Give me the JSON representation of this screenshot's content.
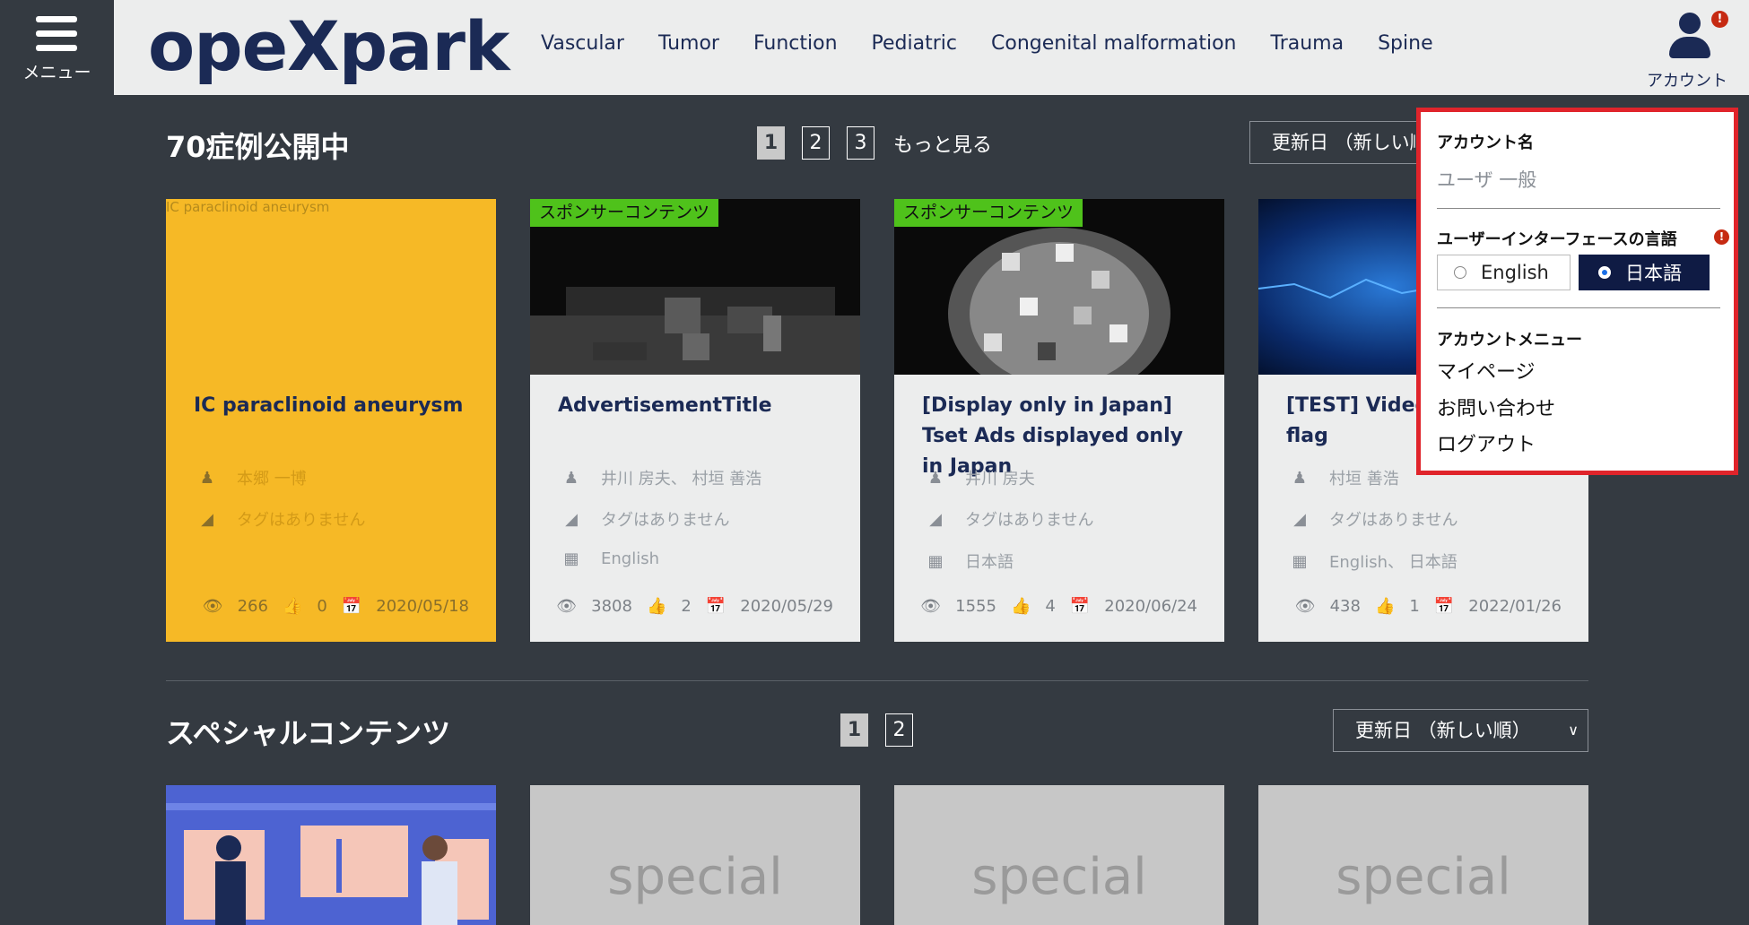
{
  "header": {
    "menu_label": "メニュー",
    "logo": "opeXpark",
    "nav": [
      "Vascular",
      "Tumor",
      "Function",
      "Pediatric",
      "Congenital malformation",
      "Trauma",
      "Spine"
    ],
    "account_label": "アカウント",
    "alert": "!"
  },
  "section1": {
    "title": "70症例公開中",
    "pages": [
      "1",
      "2",
      "3"
    ],
    "more": "もっと見る",
    "sort": "更新日 （新しい順）",
    "cards": [
      {
        "img_alt": "IC paraclinoid aneurysm",
        "title": "IC paraclinoid aneurysm",
        "authors": "本郷 一博",
        "tags": "タグはありません",
        "views": "266",
        "likes": "0",
        "date": "2020/05/18"
      },
      {
        "sponsor": "スポンサーコンテンツ",
        "title": "AdvertisementTitle",
        "authors": "井川 房夫、 村垣 善浩",
        "tags": "タグはありません",
        "language": "English",
        "views": "3808",
        "likes": "2",
        "date": "2020/05/29"
      },
      {
        "sponsor": "スポンサーコンテンツ",
        "title": "[Display only in Japan] Tset Ads displayed only in Japan",
        "authors": "井川 房夫",
        "tags": "タグはありません",
        "language": "日本語",
        "views": "1555",
        "likes": "4",
        "date": "2020/06/24"
      },
      {
        "title": "[TEST] Video hasAudio flag",
        "authors": "村垣 善浩",
        "tags": "タグはありません",
        "language": "English、 日本語",
        "views": "438",
        "likes": "1",
        "date": "2022/01/26"
      }
    ]
  },
  "section2": {
    "title": "スペシャルコンテンツ",
    "pages": [
      "1",
      "2"
    ],
    "sort": "更新日 （新しい順）",
    "placeholder": "special"
  },
  "account_menu": {
    "name_label": "アカウント名",
    "name_value": "ユーザ 一般",
    "lang_label": "ユーザーインターフェースの言語",
    "lang_en": "English",
    "lang_ja": "日本語",
    "selected_lang": "日本語",
    "menu_label": "アカウントメニュー",
    "links": [
      "マイページ",
      "お問い合わせ",
      "ログアウト"
    ]
  }
}
